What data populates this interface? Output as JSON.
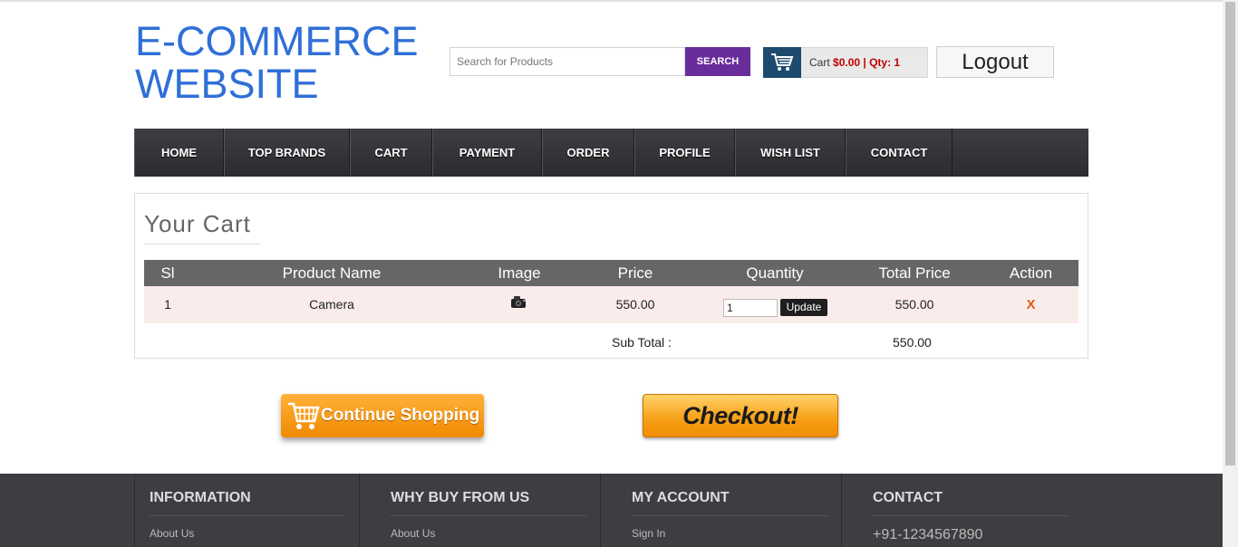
{
  "header": {
    "logo_line1": "E-COMMERCE",
    "logo_line2": "WEBSITE",
    "search_placeholder": "Search for Products",
    "search_button": "SEARCH",
    "cart_label": "Cart",
    "cart_amount": "$0.00 | Qty: 1",
    "logout": "Logout"
  },
  "nav": {
    "items": [
      "HOME",
      "TOP BRANDS",
      "CART",
      "PAYMENT",
      "ORDER",
      "PROFILE",
      "WISH LIST",
      "CONTACT"
    ]
  },
  "cart": {
    "title": "Your Cart",
    "columns": [
      "Sl",
      "Product Name",
      "Image",
      "Price",
      "Quantity",
      "Total Price",
      "Action"
    ],
    "rows": [
      {
        "sl": "1",
        "product": "Camera",
        "image_icon": "camera-icon",
        "price": "550.00",
        "quantity": "1",
        "update": "Update",
        "total": "550.00",
        "action": "X"
      }
    ],
    "subtotal_label": "Sub Total :",
    "subtotal_value": "550.00"
  },
  "actions": {
    "continue_shopping": "Continue Shopping",
    "checkout": "Checkout!"
  },
  "footer": {
    "columns": [
      {
        "heading": "INFORMATION",
        "link": "About Us"
      },
      {
        "heading": "WHY BUY FROM US",
        "link": "About Us"
      },
      {
        "heading": "MY ACCOUNT",
        "link": "Sign In"
      },
      {
        "heading": "CONTACT",
        "link": "+91-1234567890"
      }
    ]
  },
  "colors": {
    "logo": "#2f6fd8",
    "search_button": "#6a2c9a",
    "nav_bg": "#3e3e42",
    "table_header": "#666666",
    "table_row": "#fbecec",
    "delete": "#e35b12",
    "accent_orange": "#f08a00"
  }
}
